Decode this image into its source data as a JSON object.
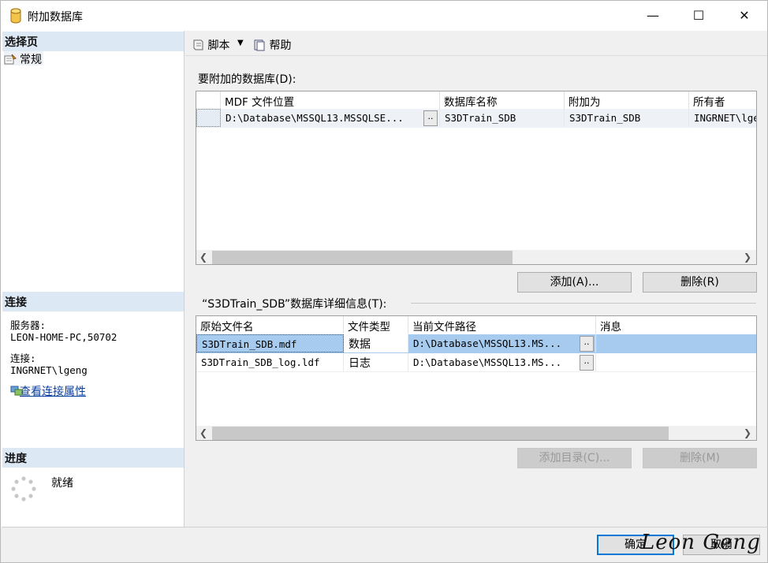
{
  "window": {
    "title": "附加数据库",
    "min": "—",
    "max": "☐",
    "close": "✕"
  },
  "left": {
    "select_page": "选择页",
    "pages": [
      {
        "label": "常规"
      }
    ],
    "connection": "连接",
    "server_label": "服务器:",
    "server_value": "LEON-HOME-PC,50702",
    "conn_label": "连接:",
    "conn_value": "INGRNET\\lgeng",
    "view_props": "查看连接属性",
    "progress": "进度",
    "status": "就绪"
  },
  "toolbar": {
    "script": "脚本",
    "help": "帮助"
  },
  "attach": {
    "label": "要附加的数据库(D):",
    "columns": [
      "MDF 文件位置",
      "数据库名称",
      "附加为",
      "所有者"
    ],
    "rows": [
      {
        "mdf": "D:\\Database\\MSSQL13.MSSQLSE...",
        "dbname": "S3DTrain_SDB",
        "attach_as": "S3DTrain_SDB",
        "owner": "INGRNET\\lgeng"
      }
    ],
    "add": "添加(A)...",
    "remove": "删除(R)"
  },
  "details": {
    "label": "“S3DTrain_SDB”数据库详细信息(T):",
    "columns": [
      "原始文件名",
      "文件类型",
      "当前文件路径",
      "消息"
    ],
    "rows": [
      {
        "name": "S3DTrain_SDB.mdf",
        "type": "数据",
        "path": "D:\\Database\\MSSQL13.MS...",
        "msg": ""
      },
      {
        "name": "S3DTrain_SDB_log.ldf",
        "type": "日志",
        "path": "D:\\Database\\MSSQL13.MS...",
        "msg": ""
      }
    ],
    "add_catalog": "添加目录(C)...",
    "remove": "删除(M)"
  },
  "footer": {
    "ok": "确定",
    "cancel": "取消"
  },
  "signature": "Leon Geng",
  "colors": {
    "selected_row": "#a6cbef",
    "header_band": "#dde8f5",
    "link": "#0a3fa0"
  }
}
